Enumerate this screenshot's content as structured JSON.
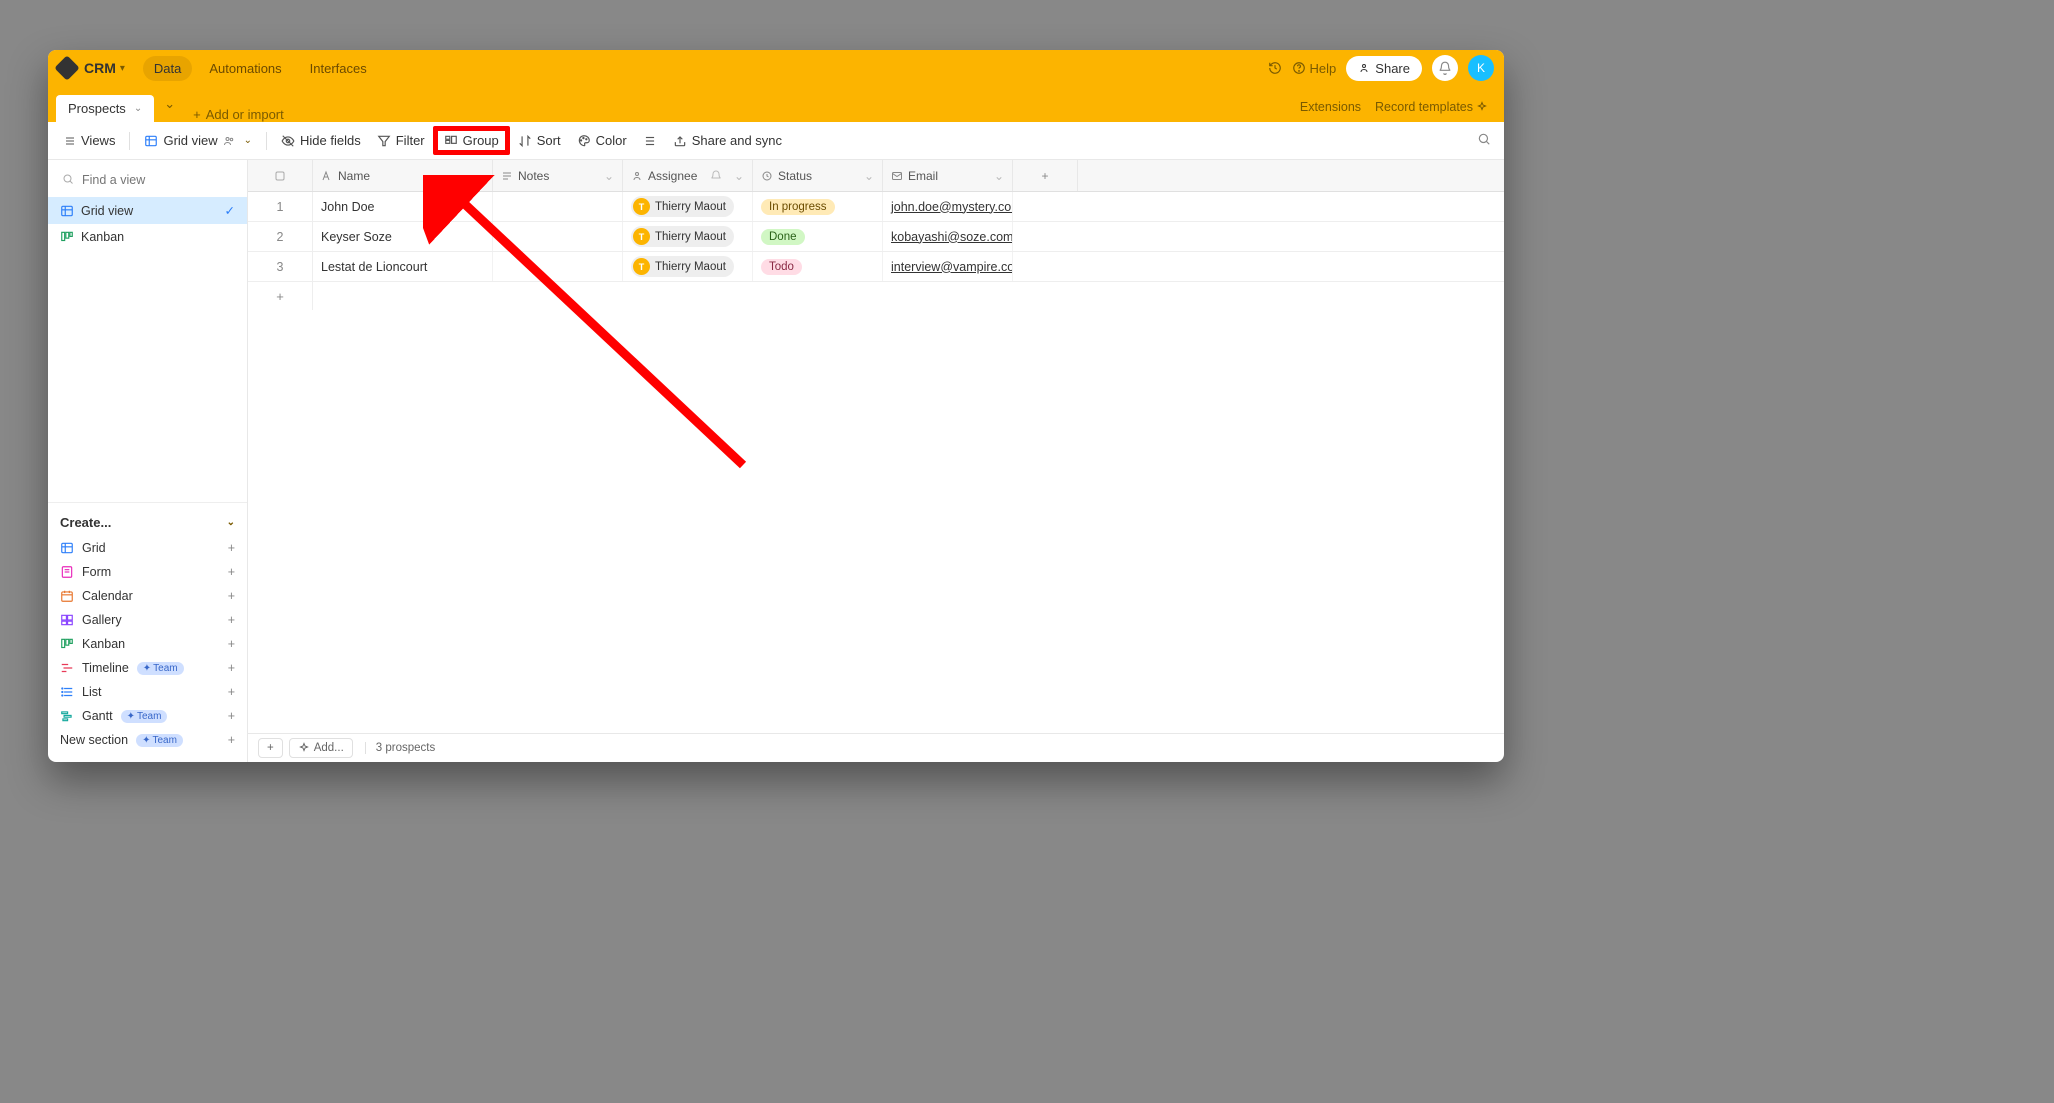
{
  "topbar": {
    "title": "CRM",
    "nav": {
      "data": "Data",
      "automations": "Automations",
      "interfaces": "Interfaces"
    },
    "help": "Help",
    "share": "Share",
    "avatar_initial": "K"
  },
  "tabbar": {
    "active_tab": "Prospects",
    "add_or_import": "Add or import",
    "extensions": "Extensions",
    "record_templates": "Record templates"
  },
  "toolbar": {
    "views": "Views",
    "grid_view": "Grid view",
    "hide_fields": "Hide fields",
    "filter": "Filter",
    "group": "Group",
    "sort": "Sort",
    "color": "Color",
    "share_sync": "Share and sync"
  },
  "sidebar": {
    "find_placeholder": "Find a view",
    "views": {
      "grid": "Grid view",
      "kanban": "Kanban"
    },
    "create_header": "Create...",
    "create": {
      "grid": "Grid",
      "form": "Form",
      "calendar": "Calendar",
      "gallery": "Gallery",
      "kanban": "Kanban",
      "timeline": "Timeline",
      "list": "List",
      "gantt": "Gantt",
      "new_section": "New section",
      "team_badge": "Team"
    }
  },
  "grid": {
    "headers": {
      "name": "Name",
      "notes": "Notes",
      "assignee": "Assignee",
      "status": "Status",
      "email": "Email"
    },
    "rows": [
      {
        "num": "1",
        "name": "John Doe",
        "assignee": "Thierry Maout",
        "status": "In progress",
        "status_class": "st-in",
        "email": "john.doe@mystery.com"
      },
      {
        "num": "2",
        "name": "Keyser Soze",
        "assignee": "Thierry Maout",
        "status": "Done",
        "status_class": "st-done",
        "email": "kobayashi@soze.com"
      },
      {
        "num": "3",
        "name": "Lestat de Lioncourt",
        "assignee": "Thierry Maout",
        "status": "Todo",
        "status_class": "st-todo",
        "email": "interview@vampire.com"
      }
    ]
  },
  "footer": {
    "add": "Add...",
    "count": "3 prospects"
  }
}
